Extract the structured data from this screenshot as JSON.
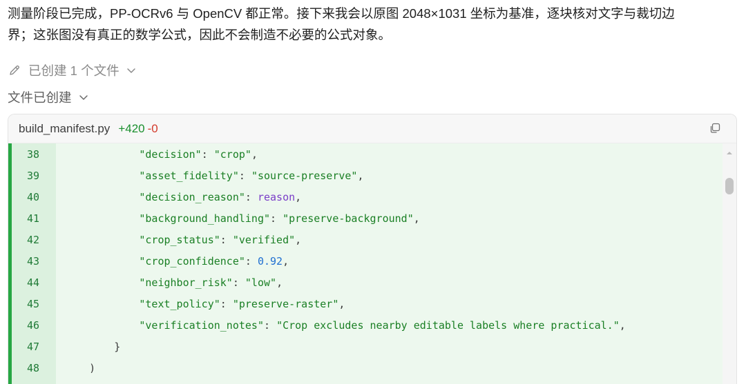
{
  "message": {
    "line1": "测量阶段已完成，PP-OCRv6 与 OpenCV 都正常。接下来我会以原图 2048×1031 坐标为基准，逐块核对文字与裁切边",
    "line2": "界；这张图没有真正的数学公式，因此不会制造不必要的公式对象。"
  },
  "action": {
    "label": "已创建 1 个文件",
    "icon": "pencil-icon"
  },
  "status": {
    "label": "文件已创建"
  },
  "file": {
    "name": "build_manifest.py",
    "additions": "+420",
    "deletions": "-0",
    "copy_icon": "copy-icon"
  },
  "code_lines": [
    {
      "num": "38",
      "indent": "            ",
      "tokens": [
        [
          "s",
          "\"decision\""
        ],
        [
          "p",
          ": "
        ],
        [
          "s",
          "\"crop\""
        ],
        [
          "p",
          ","
        ]
      ]
    },
    {
      "num": "39",
      "indent": "            ",
      "tokens": [
        [
          "s",
          "\"asset_fidelity\""
        ],
        [
          "p",
          ": "
        ],
        [
          "s",
          "\"source-preserve\""
        ],
        [
          "p",
          ","
        ]
      ]
    },
    {
      "num": "40",
      "indent": "            ",
      "tokens": [
        [
          "s",
          "\"decision_reason\""
        ],
        [
          "p",
          ": "
        ],
        [
          "v",
          "reason"
        ],
        [
          "p",
          ","
        ]
      ]
    },
    {
      "num": "41",
      "indent": "            ",
      "tokens": [
        [
          "s",
          "\"background_handling\""
        ],
        [
          "p",
          ": "
        ],
        [
          "s",
          "\"preserve-background\""
        ],
        [
          "p",
          ","
        ]
      ]
    },
    {
      "num": "42",
      "indent": "            ",
      "tokens": [
        [
          "s",
          "\"crop_status\""
        ],
        [
          "p",
          ": "
        ],
        [
          "s",
          "\"verified\""
        ],
        [
          "p",
          ","
        ]
      ]
    },
    {
      "num": "43",
      "indent": "            ",
      "tokens": [
        [
          "s",
          "\"crop_confidence\""
        ],
        [
          "p",
          ": "
        ],
        [
          "n",
          "0.92"
        ],
        [
          "p",
          ","
        ]
      ]
    },
    {
      "num": "44",
      "indent": "            ",
      "tokens": [
        [
          "s",
          "\"neighbor_risk\""
        ],
        [
          "p",
          ": "
        ],
        [
          "s",
          "\"low\""
        ],
        [
          "p",
          ","
        ]
      ]
    },
    {
      "num": "45",
      "indent": "            ",
      "tokens": [
        [
          "s",
          "\"text_policy\""
        ],
        [
          "p",
          ": "
        ],
        [
          "s",
          "\"preserve-raster\""
        ],
        [
          "p",
          ","
        ]
      ]
    },
    {
      "num": "46",
      "indent": "            ",
      "tokens": [
        [
          "s",
          "\"verification_notes\""
        ],
        [
          "p",
          ": "
        ],
        [
          "s",
          "\"Crop excludes nearby editable labels where practical.\""
        ],
        [
          "p",
          ","
        ]
      ]
    },
    {
      "num": "47",
      "indent": "        ",
      "tokens": [
        [
          "p",
          "}"
        ]
      ]
    },
    {
      "num": "48",
      "indent": "    ",
      "tokens": [
        [
          "p",
          ")"
        ]
      ]
    }
  ],
  "colors": {
    "added_bar": "#27a744",
    "added_bg": "#edf8ee",
    "string": "#1a7f24",
    "variable": "#7a3ec8",
    "number": "#1f6fd1",
    "additions": "#1a8f2e",
    "deletions": "#d33b2c"
  }
}
